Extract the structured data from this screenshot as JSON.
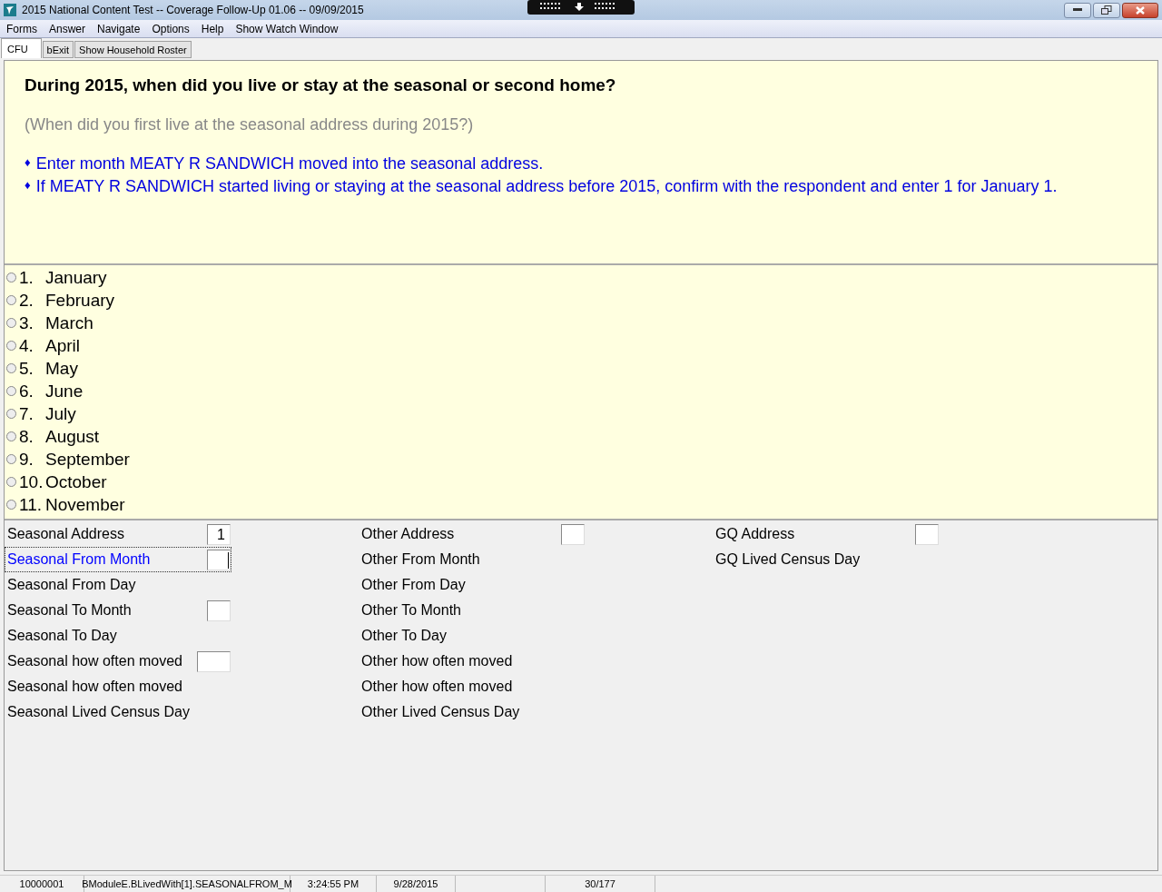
{
  "window": {
    "title": "2015 National Content Test -- Coverage Follow-Up 01.06 -- 09/09/2015"
  },
  "menu": [
    "Forms",
    "Answer",
    "Navigate",
    "Options",
    "Help",
    "Show Watch Window"
  ],
  "tabs": [
    {
      "label": "CFU",
      "selected": true
    },
    {
      "label": "bExit",
      "selected": false
    },
    {
      "label": "Show Household Roster",
      "selected": false
    }
  ],
  "question": {
    "text": "During 2015, when did you live or stay at the seasonal or second home?",
    "hint": "(When did you first live at the seasonal address during 2015?)",
    "instructions": [
      {
        "bullet": "♦",
        "text": "Enter month MEATY R SANDWICH moved into the seasonal address."
      },
      {
        "bullet": "♦",
        "text": "If MEATY R SANDWICH started living or staying at the seasonal address before 2015, confirm with the respondent and enter 1 for January 1."
      }
    ]
  },
  "answers": [
    {
      "number": "1.",
      "label": "January",
      "selected": false
    },
    {
      "number": "2.",
      "label": "February",
      "selected": false
    },
    {
      "number": "3.",
      "label": "March",
      "selected": false
    },
    {
      "number": "4.",
      "label": "April",
      "selected": false
    },
    {
      "number": "5.",
      "label": "May",
      "selected": false
    },
    {
      "number": "6.",
      "label": "June",
      "selected": false
    },
    {
      "number": "7.",
      "label": "July",
      "selected": false
    },
    {
      "number": "8.",
      "label": "August",
      "selected": false
    },
    {
      "number": "9.",
      "label": "September",
      "selected": false
    },
    {
      "number": "10.",
      "label": "October",
      "selected": false
    },
    {
      "number": "11.",
      "label": "November",
      "selected": false
    }
  ],
  "field_columns": [
    [
      {
        "label": "Seasonal Address",
        "kind": "short",
        "value": "1",
        "focused": false
      },
      {
        "label": "Seasonal From Month",
        "kind": "short",
        "focused": true
      },
      {
        "label": "Seasonal From Day",
        "kind": "none",
        "focused": false
      },
      {
        "label": "Seasonal To Month",
        "kind": "short",
        "focused": false
      },
      {
        "label": "Seasonal To Day",
        "kind": "none",
        "focused": false
      },
      {
        "label": "Seasonal how often moved",
        "kind": "long",
        "focused": false
      },
      {
        "label": "Seasonal how often moved",
        "kind": "none",
        "focused": false
      },
      {
        "label": "Seasonal Lived Census Day",
        "kind": "none",
        "focused": false
      }
    ],
    [
      {
        "label": "Other Address",
        "kind": "short",
        "focused": false
      },
      {
        "label": "Other From Month",
        "kind": "none",
        "focused": false
      },
      {
        "label": "Other From Day",
        "kind": "none",
        "focused": false
      },
      {
        "label": "Other To Month",
        "kind": "none",
        "focused": false
      },
      {
        "label": "Other To Day",
        "kind": "none",
        "focused": false
      },
      {
        "label": "Other how often moved",
        "kind": "none",
        "focused": false
      },
      {
        "label": "Other how often moved",
        "kind": "none",
        "focused": false
      },
      {
        "label": "Other Lived Census Day",
        "kind": "none",
        "focused": false
      }
    ],
    [
      {
        "label": "GQ Address",
        "kind": "short",
        "focused": false
      },
      {
        "label": "GQ Lived Census Day",
        "kind": "none",
        "focused": false
      }
    ]
  ],
  "status_bar": [
    "10000001",
    "BModuleE.BLivedWith[1].SEASONALFROM_M",
    "3:24:55 PM",
    "9/28/2015",
    "30/177"
  ]
}
